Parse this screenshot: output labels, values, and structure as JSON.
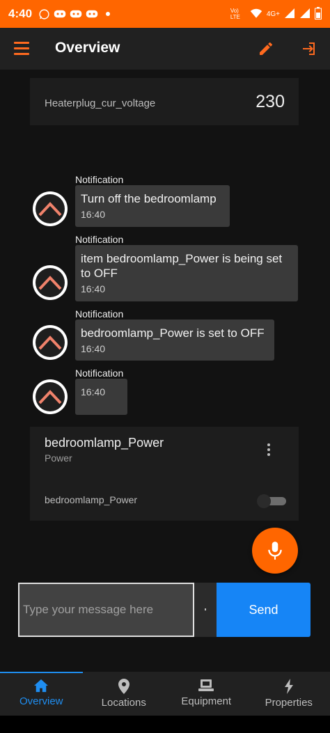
{
  "status_bar": {
    "time": "4:40",
    "network_label": "4G+",
    "carrier_label": "Vo) LTE"
  },
  "app_bar": {
    "title": "Overview"
  },
  "colors": {
    "accent": "#ff6600",
    "primary_blue": "#1685f6",
    "background": "#121212",
    "card": "#1d1d1d"
  },
  "voltage_item": {
    "label": "Heaterplug_cur_voltage",
    "value": "230"
  },
  "notifications": [
    {
      "sender": "Notification",
      "message": "Turn off the bedroomlamp",
      "time": "16:40"
    },
    {
      "sender": "Notification",
      "message": "item bedroomlamp_Power is being set to OFF",
      "time": "16:40"
    },
    {
      "sender": "Notification",
      "message": "bedroomlamp_Power is set to OFF",
      "time": "16:40"
    },
    {
      "sender": "Notification",
      "message": "",
      "time": "16:40"
    }
  ],
  "item_card": {
    "name": "bedroomlamp_Power",
    "subtitle": "Power",
    "toggle_label": "bedroomlamp_Power",
    "toggle_on": false
  },
  "composer": {
    "placeholder": "Type your message here",
    "send_label": "Send"
  },
  "bottom_nav": {
    "tabs": [
      {
        "label": "Overview",
        "icon": "home-icon",
        "active": true
      },
      {
        "label": "Locations",
        "icon": "location-pin-icon",
        "active": false
      },
      {
        "label": "Equipment",
        "icon": "equipment-icon",
        "active": false
      },
      {
        "label": "Properties",
        "icon": "lightning-icon",
        "active": false
      }
    ]
  }
}
